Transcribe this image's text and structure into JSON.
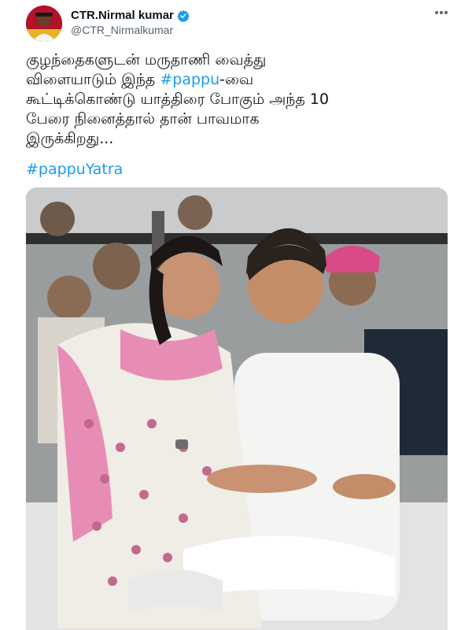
{
  "user": {
    "display_name": "CTR.Nirmal kumar",
    "handle": "@CTR_Nirmalkumar",
    "verified": true,
    "avatar_icon": "profile-avatar"
  },
  "tweet": {
    "lines": [
      {
        "text": "குழந்தைகளுடன் மருதாணி வைத்து"
      },
      {
        "text_before": "விளையாடும் இந்த ",
        "hashtag": "#pappu",
        "text_after": "-வை"
      },
      {
        "text": "கூட்டிக்கொண்டு யாத்திரை போகும் அந்த 10"
      },
      {
        "text": "பேரை நினைத்தால் தான் பாவமாக"
      },
      {
        "text": "இருக்கிறது..."
      }
    ],
    "hashtag_line": "#pappuYatra"
  },
  "icons": {
    "more": "more-options-icon",
    "verified": "verified-badge-icon"
  },
  "colors": {
    "link": "#1d9bf0",
    "text": "#0f1419",
    "secondary": "#536471",
    "verified": "#1d9bf0"
  }
}
